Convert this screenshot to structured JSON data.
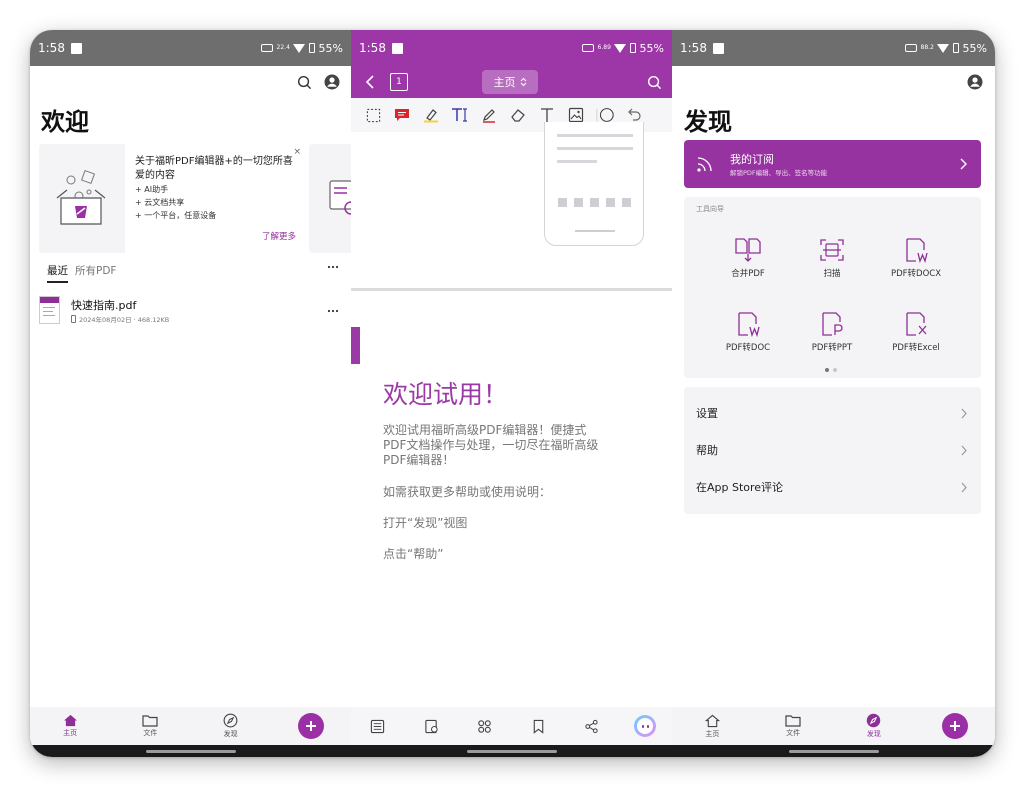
{
  "panel1": {
    "status": {
      "time": "1:58",
      "net": "22.4",
      "battery": "55%"
    },
    "title": "欢迎",
    "promo": {
      "title": "关于福昕PDF编辑器+的一切您所喜爱的内容",
      "bullets": [
        "+ AI助手",
        "+ 云文档共享",
        "+ 一个平台，任意设备"
      ],
      "more_link": "了解更多",
      "close": "×"
    },
    "tabs": {
      "recent": "最近",
      "all": "所有PDF"
    },
    "file": {
      "name": "快速指南.pdf",
      "meta": "2024年08月02日 · 468.12KB"
    },
    "nav": {
      "home": "主页",
      "files": "文件",
      "discover": "发现"
    }
  },
  "panel2": {
    "status": {
      "time": "1:58",
      "net": "6.89",
      "battery": "55%"
    },
    "page_selector": "主页",
    "page_badge": "1",
    "doc": {
      "heading": "欢迎试用！",
      "para1": "欢迎试用福昕高级PDF编辑器！便捷式PDF文档操作与处理，一切尽在福昕高级PDF编辑器！",
      "para2": "如需获取更多帮助或使用说明：",
      "para3": "打开“发现”视图",
      "para4": "点击“帮助”"
    }
  },
  "panel3": {
    "status": {
      "time": "1:58",
      "net": "88.2",
      "battery": "55%"
    },
    "title": "发现",
    "subscription": {
      "title": "我的订阅",
      "desc": "解锁PDF编辑、导出、签名等功能"
    },
    "tool_guide_label": "工具向导",
    "tools": [
      "合并PDF",
      "扫描",
      "PDF转DOCX",
      "PDF转DOC",
      "PDF转PPT",
      "PDF转Excel"
    ],
    "settings": [
      "设置",
      "帮助",
      "在App Store评论"
    ],
    "nav": {
      "home": "主页",
      "files": "文件",
      "discover": "发现"
    }
  },
  "colors": {
    "brand_purple": "#9d36a6",
    "status_gray": "#6e6e6e",
    "card_bg": "#f4f4f6"
  }
}
